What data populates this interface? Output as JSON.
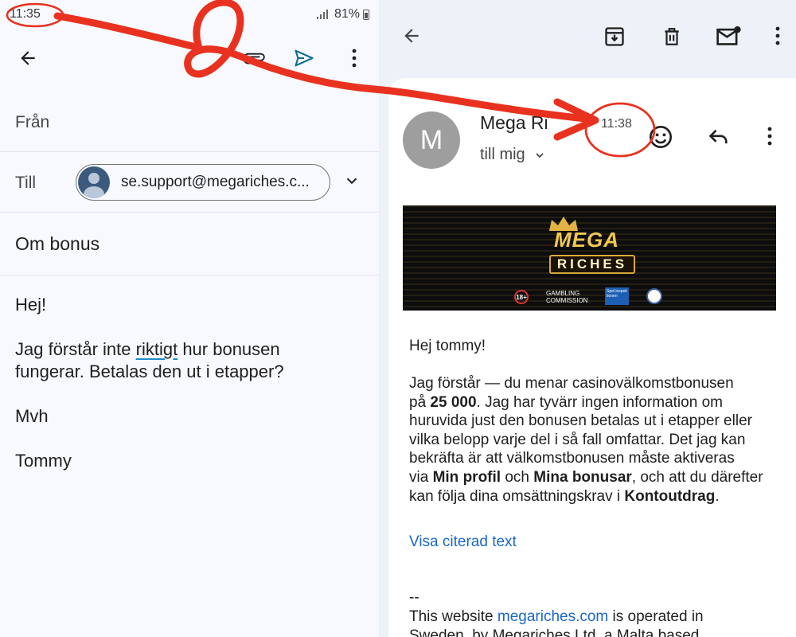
{
  "compose": {
    "status_time": "11:35",
    "battery": "81%",
    "from_label": "Från",
    "to_label": "Till",
    "to_chip": "se.support@megariches.c...",
    "subject": "Om bonus",
    "body": {
      "greeting": "Hej!",
      "line1_pre": "Jag förstår inte ",
      "line1_word": "riktigt",
      "line1_post": " hur bonusen",
      "line2": "fungerar. Betalas den ut i etapper?",
      "sign1": "Mvh",
      "sign2": "Tommy"
    }
  },
  "message": {
    "avatar_letter": "M",
    "sender": "Mega Ri",
    "recipient": "till mig",
    "time": "11:38",
    "banner": {
      "logo_top": "MEGA",
      "logo_bottom": "RICHES",
      "age": "18+",
      "gc_line1": "GAMBLING",
      "gc_line2": "COMMISSION",
      "spel_text": "Spel inspek tionen"
    },
    "greeting": "Hej tommy!",
    "p1_a": "Jag förstår — du menar casinovälkomstbonusen",
    "p1_b": "på ",
    "p1_bold": "25 000",
    "p1_c": ". Jag har tyvärr ingen information om",
    "p1_d": "huruvida just den bonusen betalas ut i etapper eller",
    "p1_e": "vilka belopp varje del i så fall omfattar. Det jag kan",
    "p1_f": "bekräfta är att välkomstbonusen måste aktiveras",
    "p1_g": "via ",
    "p1_bold2": "Min profil",
    "p1_h": " och ",
    "p1_bold3": "Mina bonusar",
    "p1_i": ", och att du därefter",
    "p1_j": "kan följa dina omsättningskrav i ",
    "p1_bold4": "Kontoutdrag",
    "p1_k": ".",
    "show_quoted": "Visa citerad text",
    "sig_dashes": "--",
    "footer_a": "This website ",
    "footer_link": "megariches.com",
    "footer_b": " is operated in",
    "footer_c": "Sweden, by Megariches Ltd, a Malta based"
  },
  "colors": {
    "annotation": "#e8321f",
    "link": "#1a66c9",
    "compose_bg": "#f7f9fe",
    "read_bg": "#edf1f8"
  },
  "icons": [
    "arrow-left-icon",
    "paperclip-icon",
    "send-icon",
    "more-vert-icon",
    "archive-icon",
    "trash-icon",
    "mark-unread-icon",
    "smiley-icon",
    "reply-icon",
    "chevron-down-icon"
  ]
}
